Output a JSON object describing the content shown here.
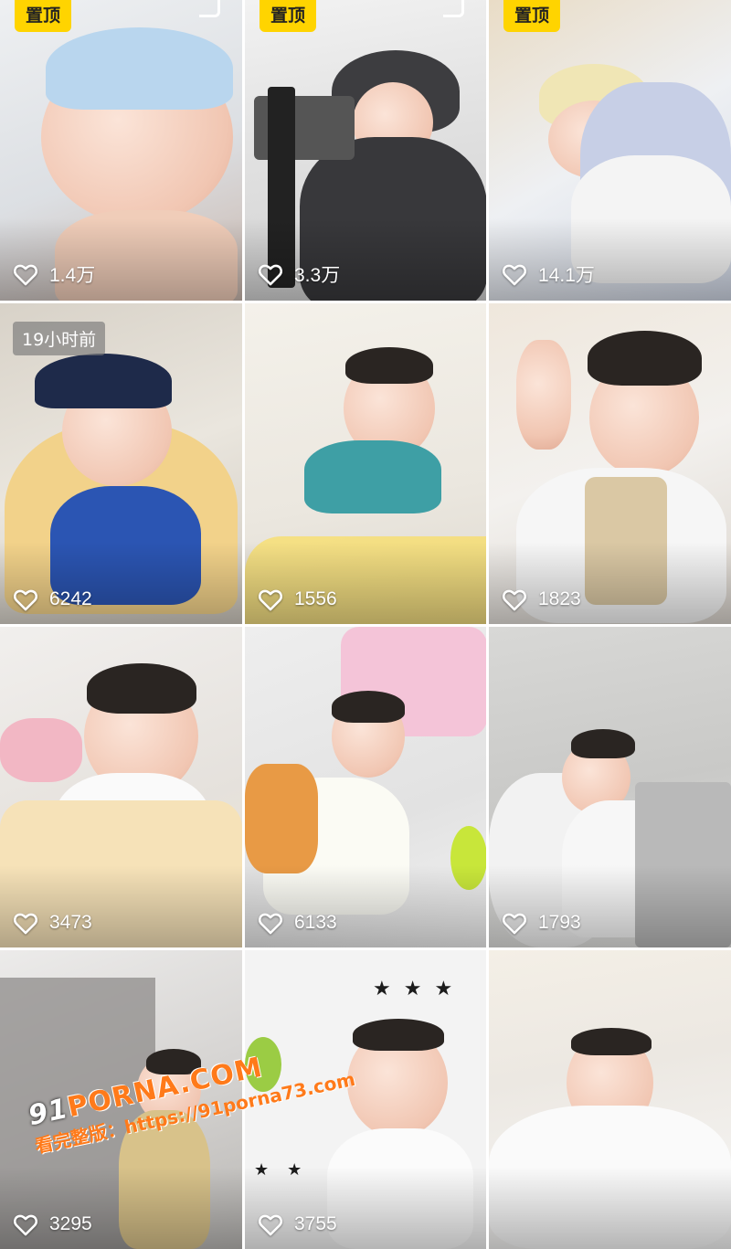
{
  "feed": {
    "pinned_label": "置顶",
    "tiles": [
      {
        "likes": "1.4万",
        "pinned": true
      },
      {
        "likes": "3.3万",
        "pinned": true
      },
      {
        "likes": "14.1万",
        "pinned": true
      },
      {
        "likes": "6242",
        "time_label": "19小时前"
      },
      {
        "likes": "1556"
      },
      {
        "likes": "1823"
      },
      {
        "likes": "3473"
      },
      {
        "likes": "6133"
      },
      {
        "likes": "1793"
      },
      {
        "likes": "3295"
      },
      {
        "likes": "3755"
      },
      {
        "likes": ""
      }
    ]
  },
  "watermark": {
    "brand_num": "91",
    "brand_text": "PORNA.COM",
    "url_prefix": "看完整版：",
    "url": "https://91porna73.com"
  },
  "colors": {
    "pin_badge": "#ffd400",
    "watermark_orange": "#ff7a1a"
  },
  "icons": {
    "like": "heart-outline-icon",
    "corner": "bookmark-corner-icon"
  }
}
